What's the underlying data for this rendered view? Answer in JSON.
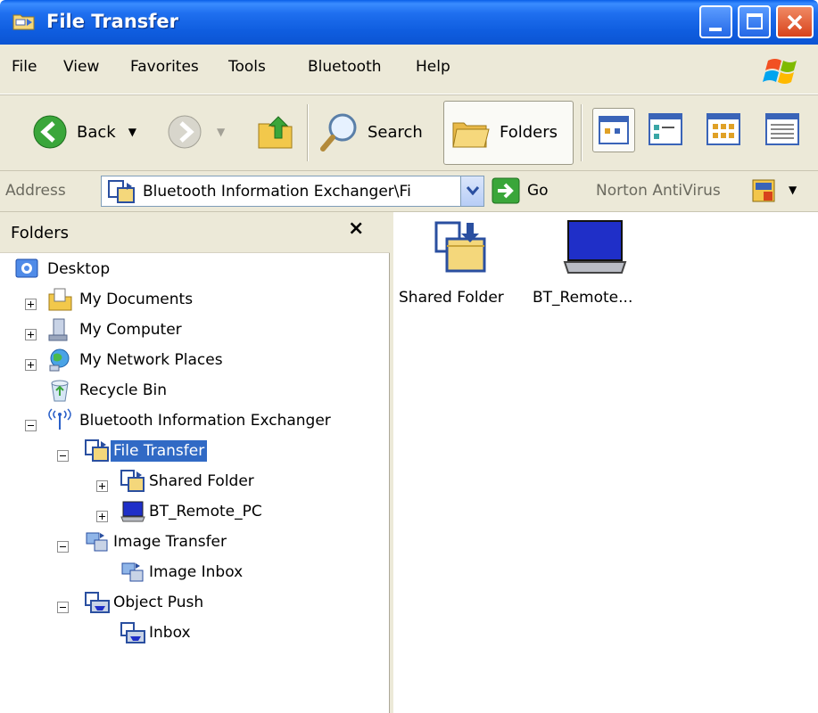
{
  "window": {
    "title": "File Transfer"
  },
  "menu": [
    "File",
    "View",
    "Favorites",
    "Tools",
    "Bluetooth",
    "Help"
  ],
  "toolbar": {
    "back_label": "Back",
    "search_label": "Search",
    "folders_label": "Folders"
  },
  "address": {
    "label": "Address",
    "value": "Bluetooth Information Exchanger\\Fi",
    "go_label": "Go",
    "norton_label": "Norton AntiVirus"
  },
  "folders_pane": {
    "title": "Folders",
    "close_glyph": "×",
    "tree": [
      {
        "label": "Desktop",
        "icon": "desktop-icon"
      },
      {
        "label": "My Documents",
        "icon": "my-documents-icon"
      },
      {
        "label": "My Computer",
        "icon": "my-computer-icon"
      },
      {
        "label": "My Network Places",
        "icon": "network-places-icon"
      },
      {
        "label": "Recycle Bin",
        "icon": "recycle-bin-icon"
      },
      {
        "label": "Bluetooth Information Exchanger",
        "icon": "bluetooth-icon"
      },
      {
        "label": "File Transfer",
        "icon": "file-transfer-icon",
        "selected": true
      },
      {
        "label": "Shared Folder",
        "icon": "shared-folder-icon"
      },
      {
        "label": "BT_Remote_PC",
        "icon": "laptop-icon"
      },
      {
        "label": "Image Transfer",
        "icon": "image-transfer-icon"
      },
      {
        "label": "Image Inbox",
        "icon": "image-inbox-icon"
      },
      {
        "label": "Object Push",
        "icon": "object-push-icon"
      },
      {
        "label": "Inbox",
        "icon": "inbox-icon"
      }
    ]
  },
  "content": {
    "items": [
      {
        "label": "Shared Folder",
        "icon": "shared-folder-icon"
      },
      {
        "label": "BT_Remote...",
        "icon": "laptop-icon"
      }
    ]
  },
  "colors": {
    "titlebar": "#0b54d3",
    "selection": "#316ac5",
    "chrome": "#ece9d8"
  }
}
